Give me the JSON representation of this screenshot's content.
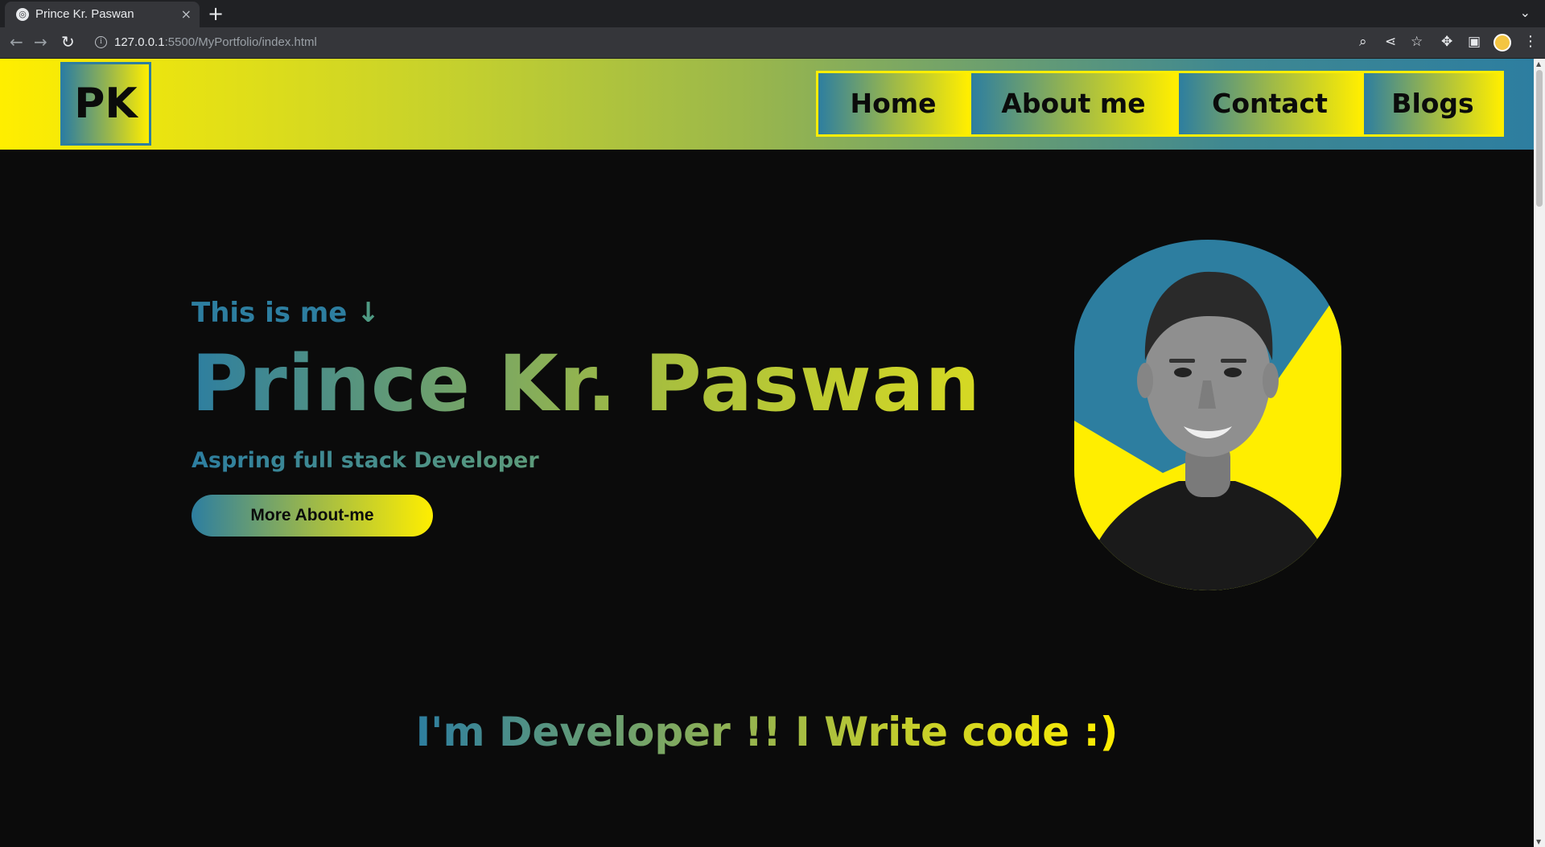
{
  "browser": {
    "tab_title": "Prince Kr. Paswan",
    "tab_close": "×",
    "new_tab": "+",
    "tab_menu": "⌄",
    "url_host": "127.0.0.1",
    "url_rest": ":5500/MyPortfolio/index.html"
  },
  "header": {
    "logo": "PK",
    "nav": [
      "Home",
      "About me",
      "Contact",
      "Blogs"
    ]
  },
  "hero": {
    "intro": "This is me",
    "intro_arrow": "↓",
    "name": "Prince Kr. Paswan",
    "role": "Aspring full stack Developer",
    "cta": "More About-me"
  },
  "tagline": "I'm Developer !! I Write code :)",
  "colors": {
    "teal": "#2d7ea0",
    "yellow": "#ffee00",
    "background": "#0b0b0b"
  },
  "icons": [
    "globe-icon",
    "back-icon",
    "forward-icon",
    "reload-icon",
    "info-icon",
    "zoom-icon",
    "share-icon",
    "star-icon",
    "extensions-icon",
    "sidepanel-icon",
    "profile-icon",
    "menu-icon"
  ]
}
